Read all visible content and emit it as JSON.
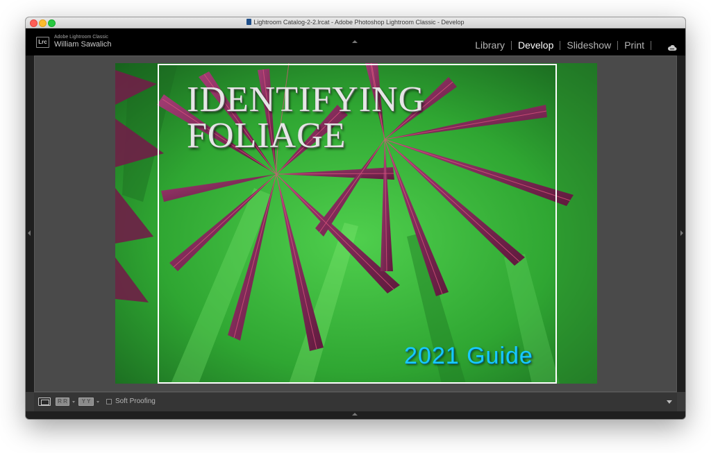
{
  "window": {
    "title": "Lightroom Catalog-2-2.lrcat - Adobe Photoshop Lightroom Classic - Develop"
  },
  "identity": {
    "badge": "Lrc",
    "app_name": "Adobe Lightroom Classic",
    "user_name": "William Sawalich"
  },
  "modules": [
    {
      "label": "Library",
      "active": false
    },
    {
      "label": "Develop",
      "active": true
    },
    {
      "label": "Slideshow",
      "active": false
    },
    {
      "label": "Print",
      "active": false
    }
  ],
  "photo": {
    "headline_line1": "IDENTIFYING",
    "headline_line2": "FOLIAGE",
    "guide_text": "2021 Guide"
  },
  "toolbar": {
    "grid_label": "R R",
    "compare_label": "Y Y",
    "soft_proofing_label": "Soft Proofing",
    "soft_proofing_checked": false
  },
  "colors": {
    "guide_text": "#18c9ff",
    "background_green": "#3fb83c",
    "leaf_purple": "#7a2350"
  },
  "icons": {
    "cloud": "cloud-sync-icon"
  }
}
